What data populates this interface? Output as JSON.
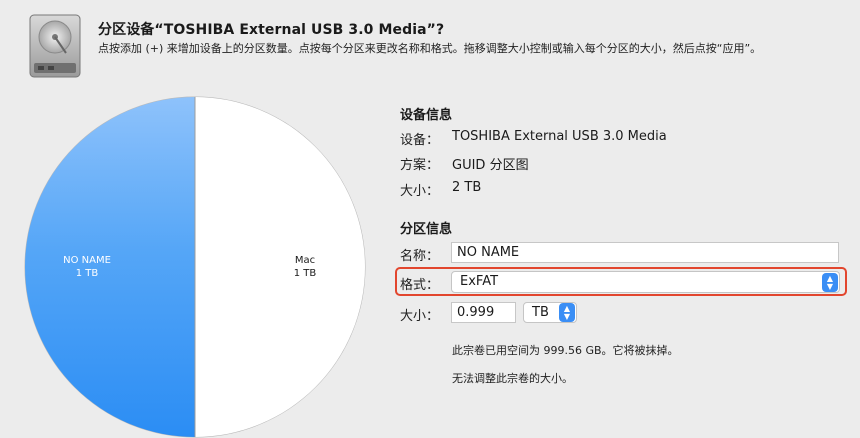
{
  "header": {
    "title": "分区设备“TOSHIBA External USB 3.0 Media”?",
    "subtitle": "点按添加 (+) 来增加设备上的分区数量。点按每个分区来更改名称和格式。拖移调整大小控制或输入每个分区的大小，然后点按“应用”。",
    "icon": "hard-drive-icon"
  },
  "pie": {
    "slices": [
      {
        "name": "NO NAME",
        "size": "1 TB",
        "value": 1,
        "color": "#2e8ef5"
      },
      {
        "name": "Mac",
        "size": "1 TB",
        "value": 1,
        "color": "#ffffff"
      }
    ]
  },
  "device_info": {
    "heading": "设备信息",
    "device_label": "设备：",
    "device_value": "TOSHIBA External USB 3.0 Media",
    "scheme_label": "方案：",
    "scheme_value": "GUID 分区图",
    "size_label": "大小：",
    "size_value": "2 TB"
  },
  "partition_info": {
    "heading": "分区信息",
    "name_label": "名称：",
    "name_value": "NO NAME",
    "format_label": "格式：",
    "format_value": "ExFAT",
    "size_label": "大小：",
    "size_value": "0.999",
    "unit_value": "TB",
    "used_note": "此宗卷已用空间为 999.56 GB。它将被抹掉。",
    "resize_note": "无法调整此宗卷的大小。"
  },
  "colors": {
    "accent": "#2e8ef5",
    "highlight": "#e2462e"
  }
}
